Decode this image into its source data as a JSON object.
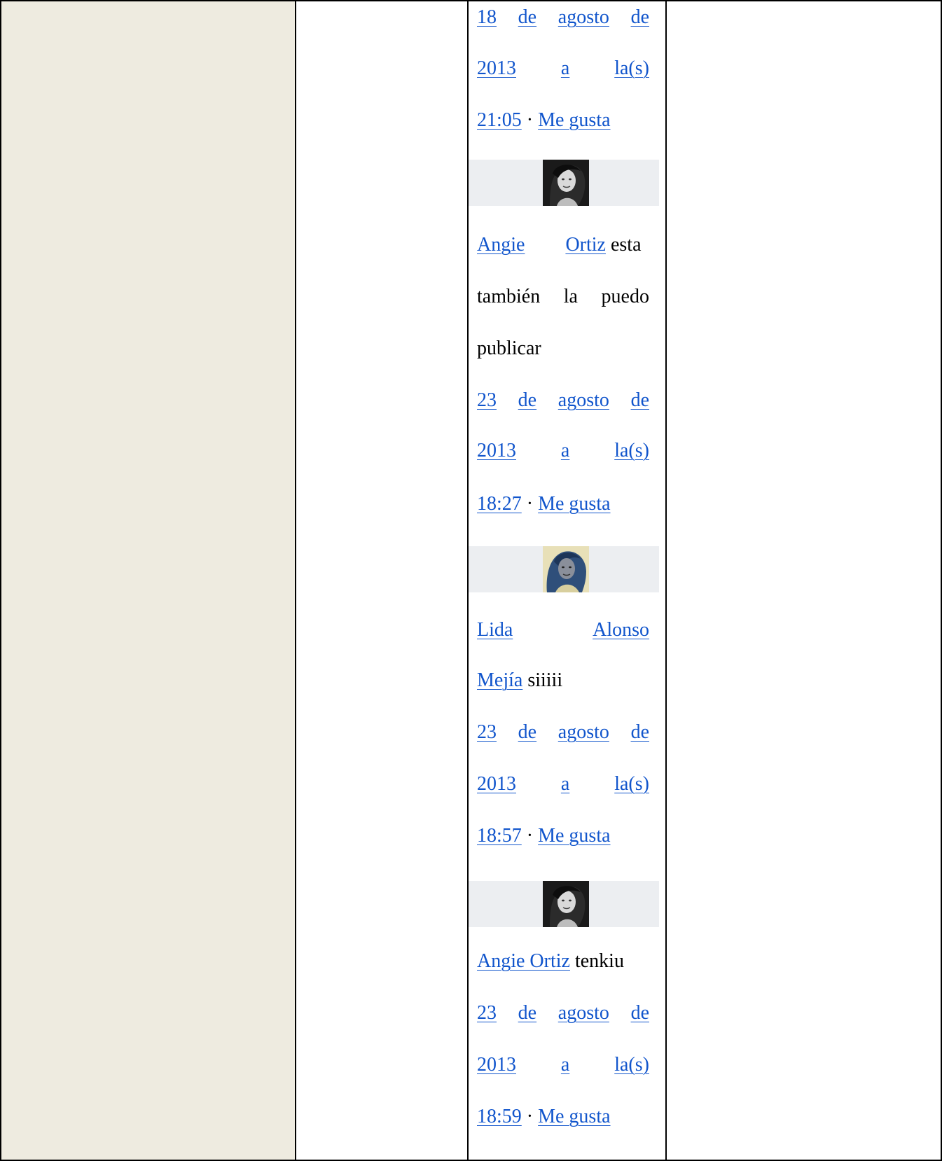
{
  "comments": [
    {
      "date_parts": [
        "18",
        "de",
        "agosto",
        "de",
        "2013",
        "a",
        "la(s)"
      ],
      "time": "21:05",
      "separator": "·",
      "like": "Me gusta"
    },
    {
      "author": "Angie Ortiz",
      "author_parts": [
        "Angie",
        "Ortiz"
      ],
      "text_first": "esta",
      "text_line2": [
        "también",
        "la",
        "puedo"
      ],
      "text_line3": "publicar",
      "date_parts": [
        "23",
        "de",
        "agosto",
        "de",
        "2013",
        "a",
        "la(s)"
      ],
      "time": "18:27",
      "separator": "·",
      "like": "Me gusta",
      "avatar_icon": "avatar-icon"
    },
    {
      "author": "Lida Alonso Mejía",
      "author_parts": [
        "Lida",
        "Alonso",
        "Mejía"
      ],
      "text": "siiiii",
      "date_parts": [
        "23",
        "de",
        "agosto",
        "de",
        "2013",
        "a",
        "la(s)"
      ],
      "time": "18:57",
      "separator": "·",
      "like": "Me gusta",
      "avatar_icon": "avatar-icon"
    },
    {
      "author": "Angie Ortiz",
      "text": "tenkiu",
      "date_parts": [
        "23",
        "de",
        "agosto",
        "de",
        "2013",
        "a",
        "la(s)"
      ],
      "time": "18:59",
      "separator": "·",
      "like": "Me gusta",
      "avatar_icon": "avatar-icon"
    }
  ],
  "colors": {
    "left_column": "#eeebe0",
    "avatar_band": "#eceef1",
    "link": "#1155cc",
    "border": "#000000"
  }
}
